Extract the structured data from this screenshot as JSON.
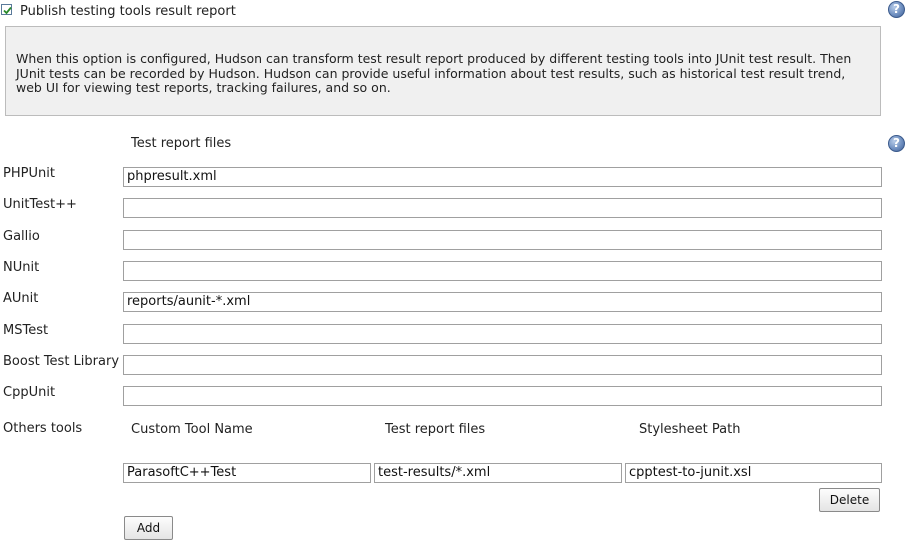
{
  "publish": {
    "checked": true,
    "label": "Publish testing tools result report"
  },
  "help_icon_glyph": "?",
  "description": "When this option is configured, Hudson can transform test result report produced by different testing tools into JUnit test result. Then JUnit tests can be recorded by Hudson. Hudson can provide useful information about test results, such as historical test result trend, web UI for viewing test reports, tracking failures, and so on.",
  "column_header": "Test report files",
  "tools": [
    {
      "label": "PHPUnit",
      "value": "phpresult.xml"
    },
    {
      "label": "UnitTest++",
      "value": ""
    },
    {
      "label": "Gallio",
      "value": ""
    },
    {
      "label": "NUnit",
      "value": ""
    },
    {
      "label": "AUnit",
      "value": "reports/aunit-*.xml"
    },
    {
      "label": "MSTest",
      "value": ""
    },
    {
      "label": "Boost Test Library",
      "value": ""
    },
    {
      "label": "CppUnit",
      "value": ""
    }
  ],
  "others": {
    "label": "Others tools",
    "headers": [
      "Custom Tool Name",
      "Test report files",
      "Stylesheet Path"
    ],
    "row": {
      "tool_name": "ParasoftC++Test",
      "report_files": "test-results/*.xml",
      "stylesheet": "cpptest-to-junit.xsl"
    },
    "delete_label": "Delete",
    "add_label": "Add"
  }
}
